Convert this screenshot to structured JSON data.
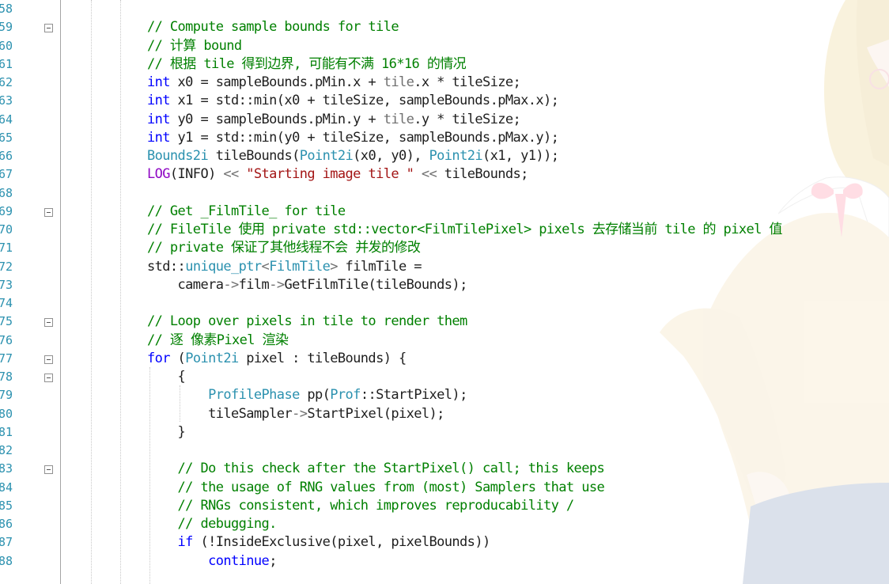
{
  "editor": {
    "line_numbers": [
      "58",
      "59",
      "60",
      "61",
      "62",
      "63",
      "64",
      "65",
      "66",
      "67",
      "68",
      "69",
      "70",
      "71",
      "72",
      "73",
      "74",
      "75",
      "76",
      "77",
      "78",
      "79",
      "80",
      "81",
      "82",
      "83",
      "84",
      "85",
      "86",
      "87",
      "88"
    ],
    "lines": [
      [],
      [
        {
          "t": "// Compute sample bounds for tile",
          "c": "c"
        }
      ],
      [
        {
          "t": "// 计算 bound",
          "c": "c"
        }
      ],
      [
        {
          "t": "// 根据 tile 得到边界, 可能有不满 16*16 的情况",
          "c": "c"
        }
      ],
      [
        {
          "t": "int",
          "c": "k"
        },
        {
          "t": " x0 = sampleBounds.pMin.x + "
        },
        {
          "t": "tile",
          "c": "g"
        },
        {
          "t": ".x * tileSize;"
        }
      ],
      [
        {
          "t": "int",
          "c": "k"
        },
        {
          "t": " x1 = std::min(x0 + tileSize, sampleBounds.pMax.x);"
        }
      ],
      [
        {
          "t": "int",
          "c": "k"
        },
        {
          "t": " y0 = sampleBounds.pMin.y + "
        },
        {
          "t": "tile",
          "c": "g"
        },
        {
          "t": ".y * tileSize;"
        }
      ],
      [
        {
          "t": "int",
          "c": "k"
        },
        {
          "t": " y1 = std::min(y0 + tileSize, sampleBounds.pMax.y);"
        }
      ],
      [
        {
          "t": "Bounds2i",
          "c": "t"
        },
        {
          "t": " tileBounds("
        },
        {
          "t": "Point2i",
          "c": "t"
        },
        {
          "t": "(x0, y0), "
        },
        {
          "t": "Point2i",
          "c": "t"
        },
        {
          "t": "(x1, y1));"
        }
      ],
      [
        {
          "t": "LOG",
          "c": "m"
        },
        {
          "t": "(INFO) "
        },
        {
          "t": "<<",
          "c": "g"
        },
        {
          "t": " "
        },
        {
          "t": "\"Starting image tile \"",
          "c": "s"
        },
        {
          "t": " "
        },
        {
          "t": "<<",
          "c": "g"
        },
        {
          "t": " tileBounds;"
        }
      ],
      [],
      [
        {
          "t": "// Get _FilmTile_ for tile",
          "c": "c"
        }
      ],
      [
        {
          "t": "// FileTile 使用 private std::vector<FilmTilePixel> pixels 去存储当前 tile 的 pixel 值",
          "c": "c"
        }
      ],
      [
        {
          "t": "// private 保证了其他线程不会 并发的修改",
          "c": "c"
        }
      ],
      [
        {
          "t": "std::"
        },
        {
          "t": "unique_ptr",
          "c": "t"
        },
        {
          "t": "<",
          "c": "g"
        },
        {
          "t": "FilmTile",
          "c": "t"
        },
        {
          "t": ">",
          "c": "g"
        },
        {
          "t": " filmTile ="
        }
      ],
      [
        {
          "t": "    camera"
        },
        {
          "t": "->",
          "c": "g"
        },
        {
          "t": "film"
        },
        {
          "t": "->",
          "c": "g"
        },
        {
          "t": "GetFilmTile(tileBounds);"
        }
      ],
      [],
      [
        {
          "t": "// Loop over pixels in tile to render them",
          "c": "c"
        }
      ],
      [
        {
          "t": "// 逐 像素Pixel 渲染",
          "c": "c"
        }
      ],
      [
        {
          "t": "for",
          "c": "k"
        },
        {
          "t": " ("
        },
        {
          "t": "Point2i",
          "c": "t"
        },
        {
          "t": " pixel : tileBounds) {"
        }
      ],
      [
        {
          "t": "    {"
        }
      ],
      [
        {
          "t": "        "
        },
        {
          "t": "ProfilePhase",
          "c": "t"
        },
        {
          "t": " pp("
        },
        {
          "t": "Prof",
          "c": "t"
        },
        {
          "t": "::StartPixel);"
        }
      ],
      [
        {
          "t": "        tileSampler"
        },
        {
          "t": "->",
          "c": "g"
        },
        {
          "t": "StartPixel(pixel);"
        }
      ],
      [
        {
          "t": "    }"
        }
      ],
      [],
      [
        {
          "t": "    "
        },
        {
          "t": "// Do this check after the StartPixel() call; this keeps",
          "c": "c"
        }
      ],
      [
        {
          "t": "    "
        },
        {
          "t": "// the usage of RNG values from (most) Samplers that use",
          "c": "c"
        }
      ],
      [
        {
          "t": "    "
        },
        {
          "t": "// RNGs consistent, which improves reproducability /",
          "c": "c"
        }
      ],
      [
        {
          "t": "    "
        },
        {
          "t": "// debugging.",
          "c": "c"
        }
      ],
      [
        {
          "t": "    "
        },
        {
          "t": "if",
          "c": "k"
        },
        {
          "t": " (!InsideExclusive(pixel, pixelBounds))"
        }
      ],
      [
        {
          "t": "        "
        },
        {
          "t": "continue",
          "c": "k"
        },
        {
          "t": ";"
        }
      ]
    ],
    "fold_markers": [
      "59",
      "69",
      "75",
      "77",
      "78",
      "83"
    ],
    "background_art": "anime-character-watermark"
  },
  "colors": {
    "comment": "#008000",
    "keyword": "#0000ff",
    "type": "#2b91af",
    "string": "#a31515",
    "macro": "#8f08c4",
    "line_number": "#2b91af",
    "text": "#1e1e1e"
  }
}
